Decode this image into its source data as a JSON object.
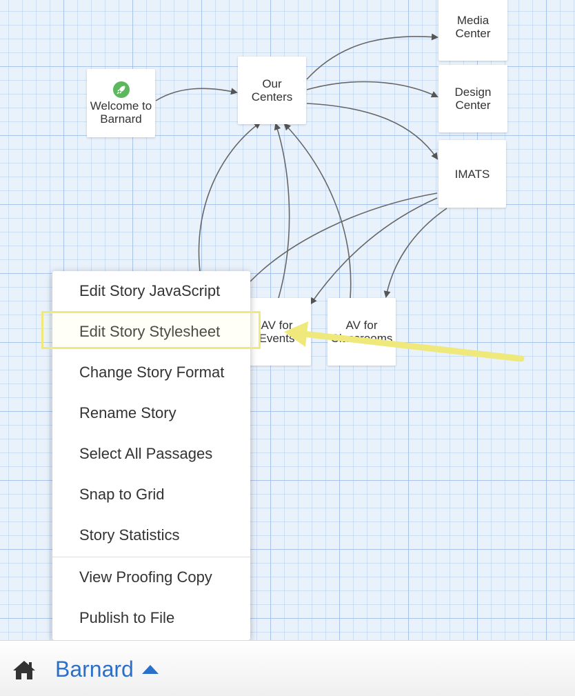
{
  "story": {
    "name": "Barnard",
    "passages": {
      "media": "Media Center",
      "design": "Design Center",
      "imats": "IMATS",
      "centers": "Our Centers",
      "welcome": "Welcome to Barnard",
      "events": "AV for Events",
      "classrooms": "AV for Classrooms"
    }
  },
  "menu": {
    "items": [
      "Edit Story JavaScript",
      "Edit Story Stylesheet",
      "Change Story Format",
      "Rename Story",
      "Select All Passages",
      "Snap to Grid",
      "Story Statistics",
      "View Proofing Copy",
      "Publish to File"
    ],
    "highlighted_index": 1
  },
  "colors": {
    "grid_background": "#e9f1fb",
    "link_color": "#555555",
    "accent": "#2a6fc9",
    "start_badge": "#5cb85c",
    "annotation": "#efe87a"
  },
  "icons": {
    "home": "home-icon",
    "caret": "caret-up-icon",
    "start": "rocket-icon"
  }
}
